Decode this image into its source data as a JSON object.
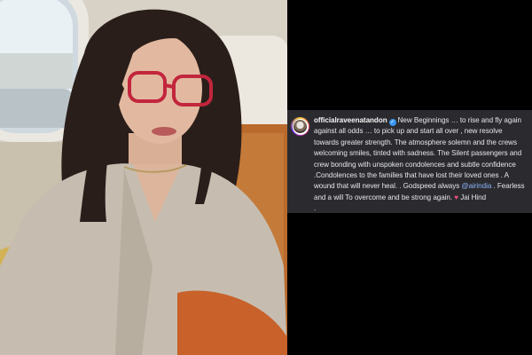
{
  "post": {
    "username": "officialraveenatandon",
    "verified_glyph": "✓",
    "avatar_icon": "profile-avatar-icon",
    "caption_segments": {
      "part1": "New Beginnings … to rise and fly again against all odds … to pick up and start all over , new resolve towards greater strength. The atmosphere solemn and the crews welcoming smiles, tinted with sadness. The Silent passengers and crew bonding with unspoken condolences and subtle confidence .Condolences to the families that have lost their loved ones . A wound that will never heal. . Godspeed always ",
      "mention": "@airindia",
      "part2": " . Fearless and a will To overcome and be strong again. ",
      "heart": "♥",
      "part3": " Jai Hind",
      "trailing": "."
    }
  },
  "colors": {
    "panel_bg": "#2b2b2f",
    "page_bg": "#000000",
    "mention": "#8ab4f8",
    "heart": "#ed4f7a",
    "verified": "#3897f0"
  }
}
